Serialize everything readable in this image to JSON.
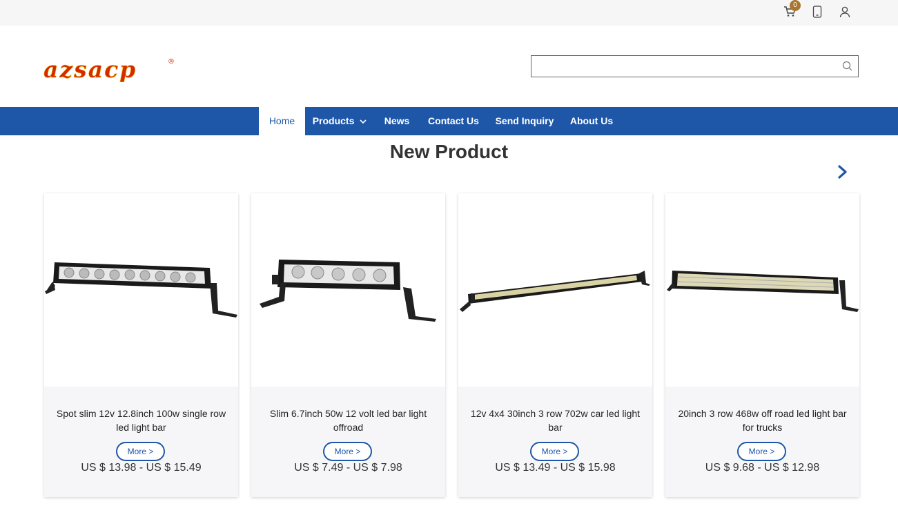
{
  "topbar": {
    "cart_count": "0",
    "icons": [
      "cart-icon",
      "phone-icon",
      "user-icon"
    ]
  },
  "header": {
    "logo_text": "azsacp",
    "logo_mark": "®",
    "search": {
      "placeholder": "",
      "value": ""
    }
  },
  "nav": {
    "items": [
      {
        "label": "Home",
        "active": true
      },
      {
        "label": "Products",
        "has_dropdown": true
      },
      {
        "label": "News"
      },
      {
        "label": "Contact Us"
      },
      {
        "label": "Send Inquiry"
      },
      {
        "label": "About Us"
      }
    ]
  },
  "section": {
    "title": "New Product"
  },
  "products": [
    {
      "title": "Spot slim 12v 12.8inch 100w single row led light bar",
      "more_label": "More >",
      "price": "US $ 13.98 - US $ 15.49"
    },
    {
      "title": "Slim 6.7inch 50w 12 volt led bar light offroad",
      "more_label": "More >",
      "price": "US $ 7.49 - US $ 7.98"
    },
    {
      "title": "12v 4x4 30inch 3 row 702w car led light bar",
      "more_label": "More >",
      "price": "US $ 13.49 - US $ 15.98"
    },
    {
      "title": "20inch 3 row 468w off road led light bar for trucks",
      "more_label": "More >",
      "price": "US $ 9.68 - US $ 12.98"
    }
  ],
  "colors": {
    "brand_blue": "#1f57a8",
    "logo_red": "#d52a00",
    "badge": "#a8762e"
  }
}
